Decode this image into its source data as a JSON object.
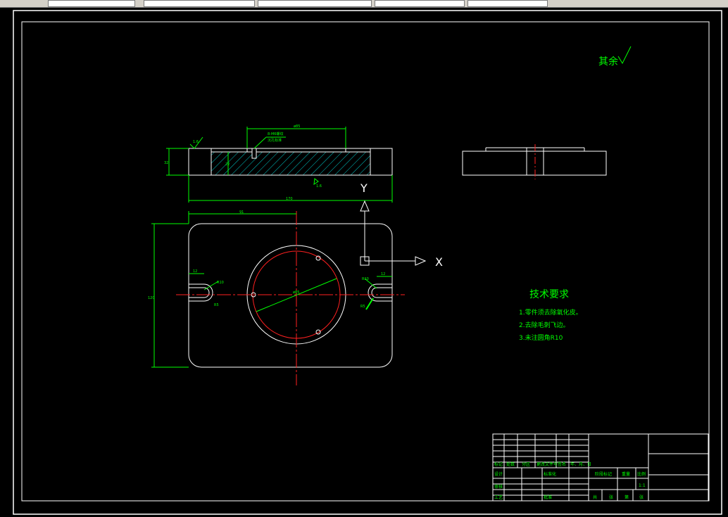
{
  "title_note": {
    "roughness": "其余"
  },
  "tech_requirements": {
    "heading": "技术要求",
    "items": [
      "1.零件须去除氧化皮。",
      "2.去除毛刺飞边。",
      "3.未注圆角R10"
    ]
  },
  "dims": {
    "top_width": "ø85",
    "hole_note1": "8-M6螺纹",
    "hole_note2": "沉孔标准",
    "height": "32",
    "inner": "22",
    "rough_top": "1.6",
    "rough_bottom": "1.6",
    "overall_width": "170",
    "half_width": "91",
    "overall_height": "120",
    "slot_left": "12",
    "slot_right": "12",
    "slot_r_left": "R10",
    "slot_r_left2": "R5",
    "slot_r_right": "R10",
    "slot_r_right2": "R5",
    "diameter": "ø85"
  },
  "ucs": {
    "x_label": "X",
    "y_label": "Y"
  },
  "title_block": {
    "labels": [
      "标记",
      "处数",
      "分区",
      "更改文件号",
      "签名",
      "年、月、日",
      "设计",
      "标准化",
      "阶段标记",
      "重量",
      "比例",
      "审核",
      "工艺",
      "批准",
      "共",
      "张",
      "第",
      "张"
    ],
    "scale": "1:1"
  }
}
